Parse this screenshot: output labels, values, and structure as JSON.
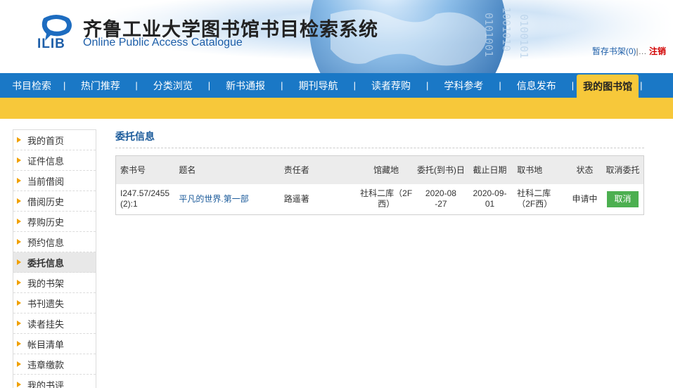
{
  "header": {
    "logo_text": "ILIB",
    "title": "齐鲁工业大学图书馆书目检索系统",
    "subtitle": "Online Public Access Catalogue",
    "shelf_link": "暂存书架(0)",
    "separator": "|",
    "user_name": "…",
    "logout": "注销"
  },
  "nav": {
    "separator": "|",
    "items": [
      {
        "label": "书目检索"
      },
      {
        "label": "热门推荐"
      },
      {
        "label": "分类浏览"
      },
      {
        "label": "新书通报"
      },
      {
        "label": "期刊导航"
      },
      {
        "label": "读者荐购"
      },
      {
        "label": "学科参考"
      },
      {
        "label": "信息发布"
      },
      {
        "label": "我的图书馆",
        "active": true
      }
    ]
  },
  "sidebar": {
    "items": [
      {
        "label": "我的首页"
      },
      {
        "label": "证件信息"
      },
      {
        "label": "当前借阅"
      },
      {
        "label": "借阅历史"
      },
      {
        "label": "荐购历史"
      },
      {
        "label": "预约信息"
      },
      {
        "label": "委托信息",
        "active": true
      },
      {
        "label": "我的书架"
      },
      {
        "label": "书刊遗失"
      },
      {
        "label": "读者挂失"
      },
      {
        "label": "帐目清单"
      },
      {
        "label": "违章缴款"
      },
      {
        "label": "我的书评"
      }
    ]
  },
  "main": {
    "title": "委托信息",
    "table": {
      "headers": [
        "索书号",
        "题名",
        "责任者",
        "馆藏地",
        "委托(到书)日",
        "截止日期",
        "取书地",
        "状态",
        "取消委托"
      ],
      "rows": [
        {
          "call_no": "I247.57/2455(2):1",
          "title": "平凡的世界.第一部",
          "author": "路遥著",
          "location": "社科二库（2F西）",
          "entrust_date": "2020-08-27",
          "due_date": "2020-09-01",
          "pickup": "社科二库（2F西）",
          "status": "申请中",
          "cancel_label": "取消"
        }
      ]
    }
  },
  "colors": {
    "nav_blue": "#1a78c6",
    "nav_yellow": "#f7c83a",
    "title_blue": "#1a5a9a",
    "cancel_green": "#4caf50",
    "logout_red": "#d10000"
  }
}
